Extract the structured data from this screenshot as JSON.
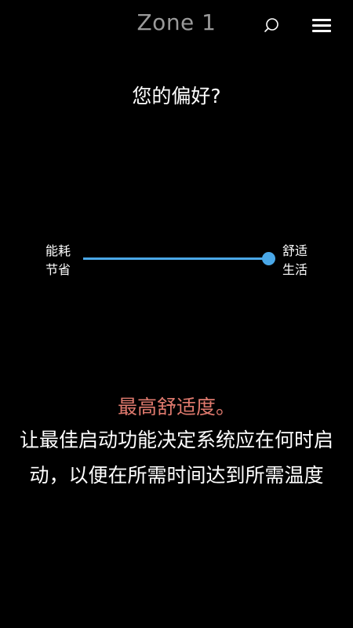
{
  "header": {
    "title": "Zone 1",
    "search_icon": "search-icon",
    "menu_icon": "menu-icon"
  },
  "preference": {
    "question": "您的偏好?",
    "left_label_line1": "能耗",
    "left_label_line2": "节省",
    "right_label_line1": "舒适",
    "right_label_line2": "生活",
    "slider_value": 1.0,
    "accent_color": "#4aa8e8"
  },
  "description": {
    "highlight": "最高舒适度。",
    "highlight_color": "#e07a6e",
    "body": "让最佳启动功能决定系统应在何时启动，以便在所需时间达到所需温度"
  }
}
